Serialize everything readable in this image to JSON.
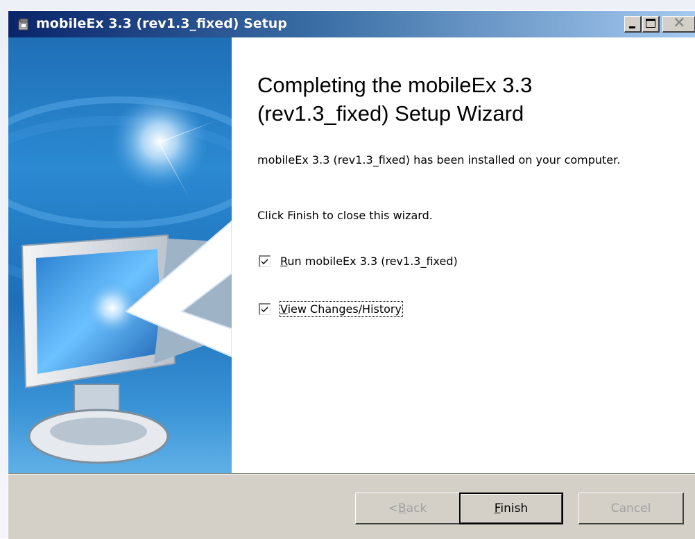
{
  "window": {
    "title": "mobileEx 3.3 (rev1.3_fixed) Setup",
    "title_icon": "installer-icon",
    "controls": [
      "minimize",
      "maximize",
      "close"
    ]
  },
  "banner": {
    "image": "computer-monitor-with-arrow-illustration"
  },
  "content": {
    "heading": "Completing the mobileEx 3.3 (rev1.3_fixed) Setup Wizard",
    "installed_text": "mobileEx 3.3 (rev1.3_fixed) has been installed on your computer.",
    "click_text": "Click Finish to close this wizard.",
    "checkboxes": [
      {
        "label_mnemonic": "R",
        "label_rest": "un mobileEx 3.3 (rev1.3_fixed)",
        "checked": true
      },
      {
        "label_mnemonic": "V",
        "label_rest": "iew Changes/History",
        "checked": true,
        "focused": true
      }
    ]
  },
  "buttons": {
    "back": {
      "prefix": "< ",
      "mnemonic": "B",
      "rest": "ack",
      "enabled": false
    },
    "finish": {
      "mnemonic": "F",
      "rest": "inish",
      "enabled": true,
      "default": true
    },
    "cancel": {
      "label": "Cancel",
      "enabled": false
    }
  },
  "colors": {
    "titlebar_start": "#0a246a",
    "titlebar_end": "#a6caf0",
    "dialog_face": "#d4d0c8",
    "banner_blue": "#2b8ad2",
    "disabled_text": "#a0a0a0"
  }
}
